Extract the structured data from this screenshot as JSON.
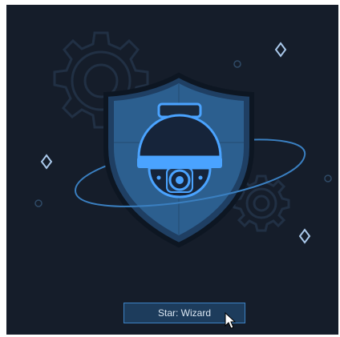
{
  "wizard": {
    "start_label": "Star: Wizard"
  },
  "icons": {
    "hero": "security-camera-shield-icon",
    "background_gears": "gear-icon",
    "sparkles": "sparkle-icon",
    "cursor": "mouse-pointer-icon"
  },
  "colors": {
    "background": "#151d2a",
    "shield_fill": "#2c5f8f",
    "shield_rim": "#1f3f63",
    "camera_accent": "#4aa3ff",
    "orbit_line": "#3a7fc0",
    "button_fill": "#1d3c5c",
    "button_border": "#3d82c4"
  }
}
